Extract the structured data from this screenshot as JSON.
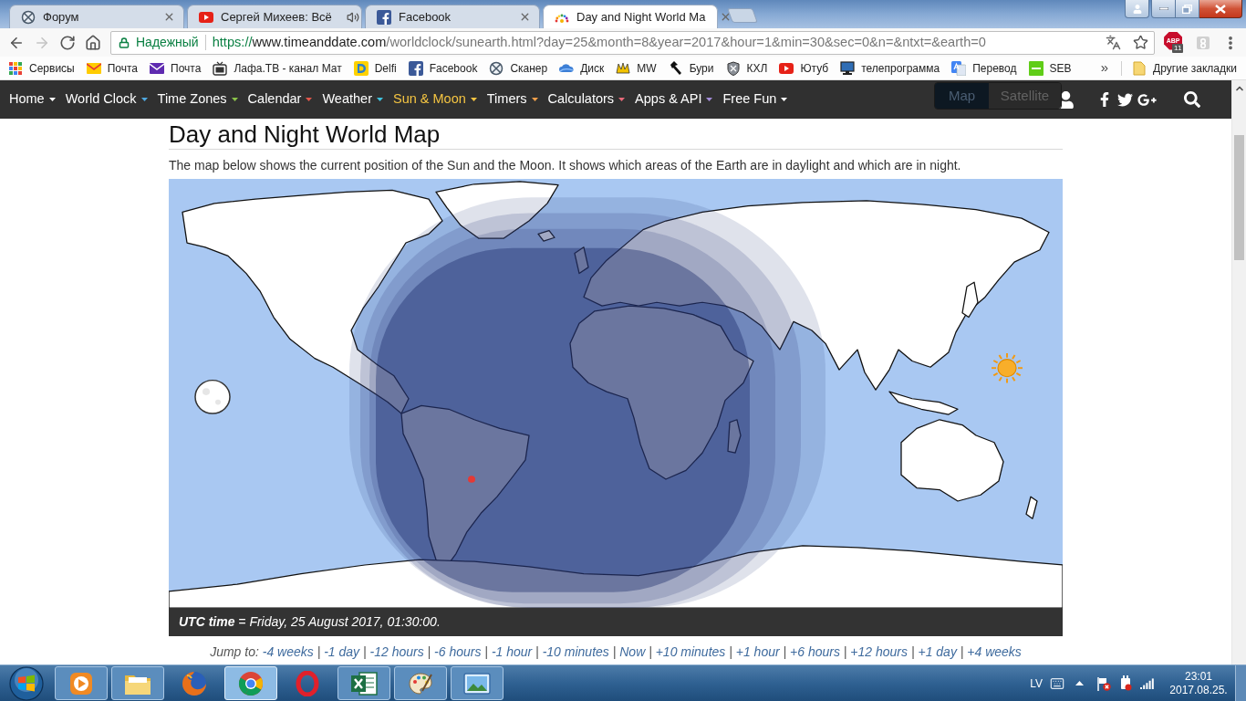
{
  "browser": {
    "tabs": [
      {
        "title": "Форум",
        "selected": false,
        "audio_playing": false
      },
      {
        "title": "Сергей Михеев: Всё",
        "selected": false,
        "audio_playing": true
      },
      {
        "title": "Facebook",
        "selected": false,
        "audio_playing": false
      },
      {
        "title": "Day and Night World Ma",
        "selected": true,
        "audio_playing": false
      }
    ]
  },
  "toolbar": {
    "buttons": [
      {
        "kind": "back",
        "disabled": false
      },
      {
        "kind": "forward",
        "disabled": true
      },
      {
        "kind": "reload",
        "disabled": false
      },
      {
        "kind": "home",
        "disabled": false
      }
    ],
    "omnibox": {
      "security_label": "Надежный",
      "url_scheme": "https://",
      "url_host": "www.timeanddate.com",
      "url_path": "/worldclock/sunearth.html?day=25&month=8&year=2017&hour=1&min=30&sec=0&n=&ntxt=&earth=0"
    },
    "adblock_label": "ABP",
    "adblock_badge": "11"
  },
  "bookmarks": {
    "items": [
      "Сервисы",
      "Почта",
      "Почта",
      "Лафа.ТВ - канал Мат",
      "Delfi",
      "Facebook",
      "Сканер",
      "Диск",
      "MW",
      "Бури",
      "КХЛ",
      "Ютуб",
      "телепрограмма",
      "Перевод",
      "SEB"
    ],
    "overflow": "»",
    "other": "Другие закладки"
  },
  "site_nav": {
    "items": [
      {
        "label": "Home",
        "color": "#ffffff",
        "selected": false
      },
      {
        "label": "World Clock",
        "color": "#4fa8e0",
        "selected": false
      },
      {
        "label": "Time Zones",
        "color": "#8bc34a",
        "selected": false
      },
      {
        "label": "Calendar",
        "color": "#e2574c",
        "selected": false
      },
      {
        "label": "Weather",
        "color": "#40c4e0",
        "selected": false
      },
      {
        "label": "Sun & Moon",
        "color": "#f5c542",
        "selected": true
      },
      {
        "label": "Timers",
        "color": "#f0a04b",
        "selected": false
      },
      {
        "label": "Calculators",
        "color": "#e86a7a",
        "selected": false
      },
      {
        "label": "Apps & API",
        "color": "#a38cd9",
        "selected": false
      },
      {
        "label": "Free Fun",
        "color": "#ffffff",
        "selected": false
      }
    ],
    "map_toggle": [
      {
        "label": "Map",
        "selected": true
      },
      {
        "label": "Satellite",
        "selected": false
      }
    ]
  },
  "page": {
    "title": "Day and Night World Map",
    "intro": "The map below shows the current position of the Sun and the Moon. It shows which areas of the Earth are in daylight and which are in night.",
    "map_caption": "**UTC time** = Friday, 25 August 2017, 01:30:00.",
    "jump": {
      "label": "Jump to:",
      "separator": "|",
      "links": [
        "-4 weeks",
        "-1 day",
        "-12 hours",
        "-6 hours",
        "-1 hour",
        "-10 minutes",
        "Now",
        "+10 minutes",
        "+1 hour",
        "+6 hours",
        "+12 hours",
        "+1 day",
        "+4 weeks"
      ]
    }
  },
  "taskbar": {
    "apps": [
      {
        "running": true,
        "selected": false
      },
      {
        "running": true,
        "selected": false
      },
      {
        "running": false,
        "selected": false
      },
      {
        "running": true,
        "selected": true
      },
      {
        "running": false,
        "selected": false
      },
      {
        "running": true,
        "selected": false
      },
      {
        "running": true,
        "selected": false
      },
      {
        "running": true,
        "selected": false
      }
    ],
    "tray": {
      "language": "LV",
      "time": "23:01",
      "date": "2017.08.25."
    }
  }
}
